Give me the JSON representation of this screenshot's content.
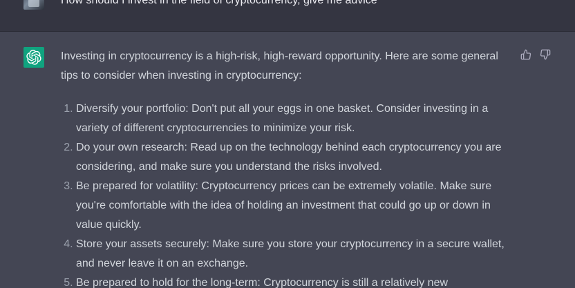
{
  "user_message": {
    "text": "How should I invest in the field of cryptocurrency, give me advice"
  },
  "assistant_message": {
    "intro": "Investing in cryptocurrency is a high-risk, high-reward opportunity. Here are some general tips to consider when investing in cryptocurrency:",
    "tips": [
      {
        "text": "Diversify your portfolio: Don't put all your eggs in one basket. Consider investing in a variety of different cryptocurrencies to minimize your risk."
      },
      {
        "text": "Do your own research: Read up on the technology behind each cryptocurrency you are considering, and make sure you understand the risks involved."
      },
      {
        "text": "Be prepared for volatility: Cryptocurrency prices can be extremely volatile. Make sure you're comfortable with the idea of holding an investment that could go up or down in value quickly."
      },
      {
        "text": "Store your assets securely: Make sure you store your cryptocurrency in a secure wallet, and never leave it on an exchange."
      },
      {
        "text": "Be prepared to hold for the long-term: Cryptocurrency is still a relatively new"
      }
    ]
  },
  "icons": {
    "assistant_avatar": "openai-logo-icon",
    "thumbs_up": "thumbs-up-icon",
    "thumbs_down": "thumbs-down-icon"
  },
  "colors": {
    "user_bg": "#343541",
    "assistant_bg": "#444654",
    "avatar_green": "#10a37f",
    "text": "#d1d5db"
  }
}
